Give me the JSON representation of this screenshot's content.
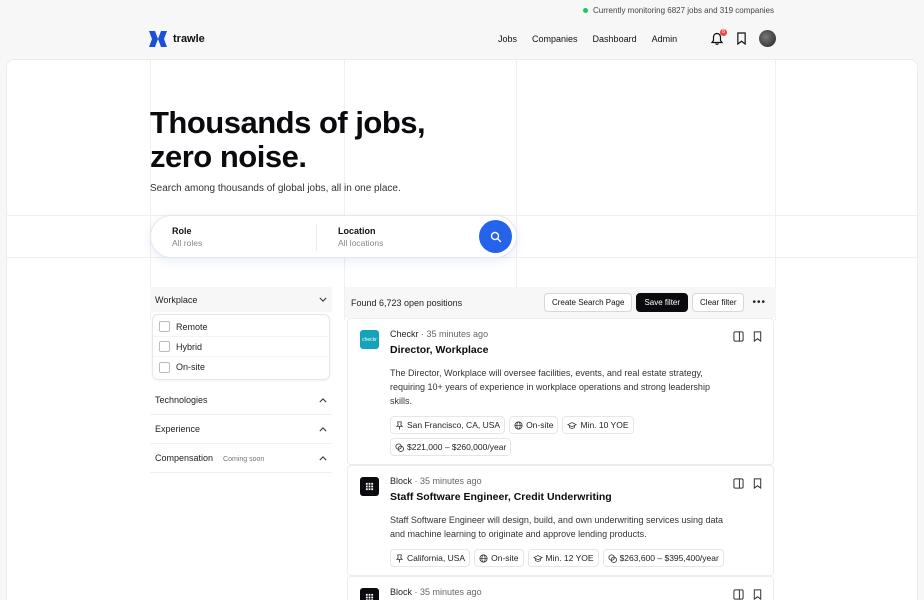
{
  "topbar": {
    "monitor_text": "Currently monitoring 6827 jobs and 319 companies"
  },
  "brand": {
    "name": "trawle",
    "color": "#1d4ed8"
  },
  "nav": {
    "links": [
      "Jobs",
      "Companies",
      "Dashboard",
      "Admin"
    ],
    "notification_count": "8"
  },
  "hero": {
    "title_line1": "Thousands of jobs,",
    "title_line2": "zero noise.",
    "subtitle": "Search among thousands of global jobs, all in one place."
  },
  "search": {
    "role_label": "Role",
    "role_placeholder": "All roles",
    "location_label": "Location",
    "location_placeholder": "All locations"
  },
  "filters": {
    "workplace": {
      "label": "Workplace",
      "options": [
        "Remote",
        "Hybrid",
        "On-site"
      ]
    },
    "technologies": {
      "label": "Technologies"
    },
    "experience": {
      "label": "Experience"
    },
    "compensation": {
      "label": "Compensation",
      "badge": "Coming soon"
    }
  },
  "results": {
    "count_text": "Found 6,723 open positions",
    "create_search_page": "Create Search Page",
    "save_filter": "Save filter",
    "clear_filter": "Clear filter",
    "jobs": [
      {
        "company": "Checkr",
        "logo_text": "checkr",
        "logo_color": "#14a3b8",
        "ago": "35 minutes ago",
        "title": "Director, Workplace",
        "description": "The Director, Workplace will oversee facilities, events, and real estate strategy, requiring 10+ years of experience in workplace operations and strong leadership skills.",
        "location": "San Francisco, CA, USA",
        "workplace": "On-site",
        "experience": "Min. 10 YOE",
        "salary": "$221,000 – $260,000/year"
      },
      {
        "company": "Block",
        "logo_text": "",
        "logo_color": "#0b0b0f",
        "ago": "35 minutes ago",
        "title": "Staff Software Engineer, Credit Underwriting",
        "description": "Staff Software Engineer will design, build, and own underwriting services using data and machine learning to originate and approve lending products.",
        "location": "California, USA",
        "workplace": "On-site",
        "experience": "Min. 12 YOE",
        "salary": "$263,600 – $395,400/year"
      },
      {
        "company": "Block",
        "logo_text": "",
        "logo_color": "#0b0b0f",
        "ago": "35 minutes ago"
      }
    ]
  }
}
